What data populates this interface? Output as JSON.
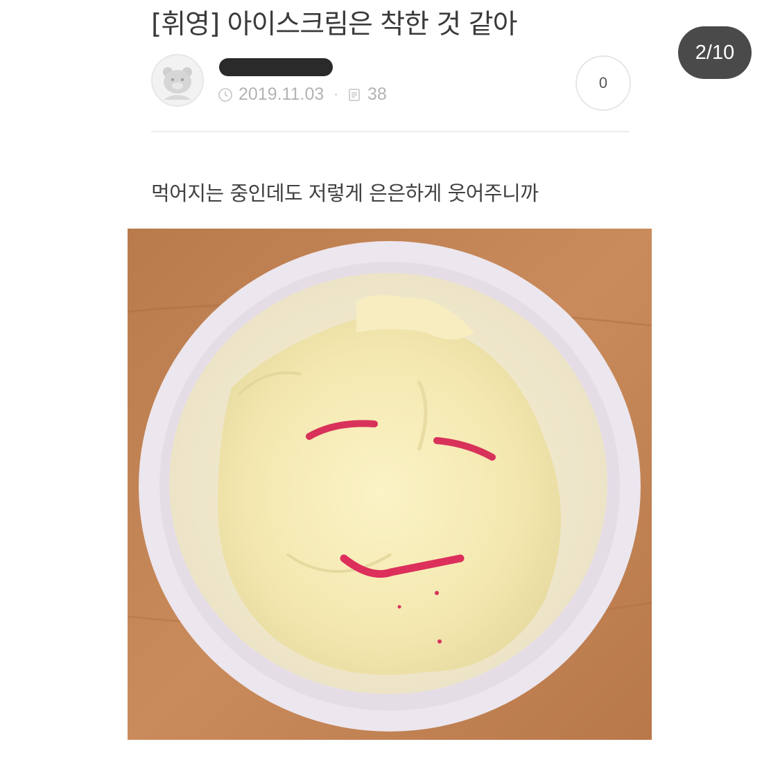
{
  "post": {
    "title": "[휘영] 아이스크림은 착한 것 같아",
    "date": "2019.11.03",
    "views": "38",
    "comments": "0",
    "body": "먹어지는 중인데도 저렇게 은은하게 웃어주니까"
  },
  "viewer": {
    "page_counter": "2/10"
  },
  "icons": {
    "date": "clock-icon",
    "views": "document-icon"
  },
  "colors": {
    "counter_bg": "#4a4a4a",
    "meta_text": "#b3b3b3",
    "title_text": "#3a3a3a"
  }
}
